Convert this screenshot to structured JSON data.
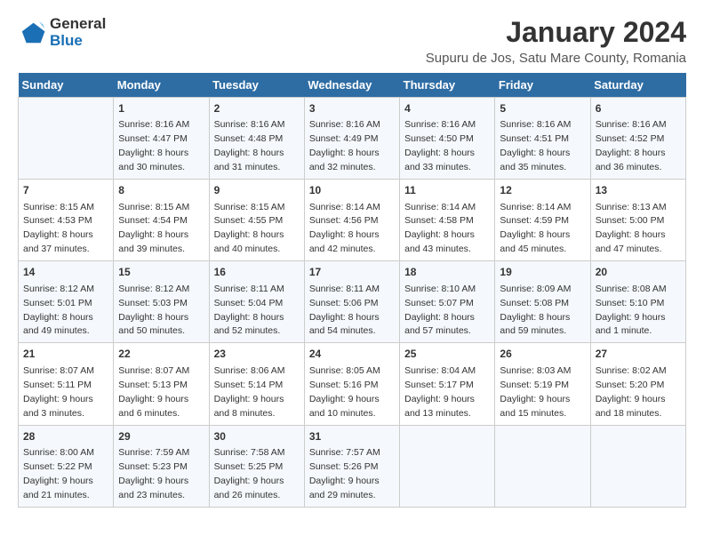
{
  "logo": {
    "line1": "General",
    "line2": "Blue"
  },
  "title": "January 2024",
  "subtitle": "Supuru de Jos, Satu Mare County, Romania",
  "weekdays": [
    "Sunday",
    "Monday",
    "Tuesday",
    "Wednesday",
    "Thursday",
    "Friday",
    "Saturday"
  ],
  "weeks": [
    [
      {
        "day": "",
        "sunrise": "",
        "sunset": "",
        "daylight": ""
      },
      {
        "day": "1",
        "sunrise": "Sunrise: 8:16 AM",
        "sunset": "Sunset: 4:47 PM",
        "daylight": "Daylight: 8 hours and 30 minutes."
      },
      {
        "day": "2",
        "sunrise": "Sunrise: 8:16 AM",
        "sunset": "Sunset: 4:48 PM",
        "daylight": "Daylight: 8 hours and 31 minutes."
      },
      {
        "day": "3",
        "sunrise": "Sunrise: 8:16 AM",
        "sunset": "Sunset: 4:49 PM",
        "daylight": "Daylight: 8 hours and 32 minutes."
      },
      {
        "day": "4",
        "sunrise": "Sunrise: 8:16 AM",
        "sunset": "Sunset: 4:50 PM",
        "daylight": "Daylight: 8 hours and 33 minutes."
      },
      {
        "day": "5",
        "sunrise": "Sunrise: 8:16 AM",
        "sunset": "Sunset: 4:51 PM",
        "daylight": "Daylight: 8 hours and 35 minutes."
      },
      {
        "day": "6",
        "sunrise": "Sunrise: 8:16 AM",
        "sunset": "Sunset: 4:52 PM",
        "daylight": "Daylight: 8 hours and 36 minutes."
      }
    ],
    [
      {
        "day": "7",
        "sunrise": "Sunrise: 8:15 AM",
        "sunset": "Sunset: 4:53 PM",
        "daylight": "Daylight: 8 hours and 37 minutes."
      },
      {
        "day": "8",
        "sunrise": "Sunrise: 8:15 AM",
        "sunset": "Sunset: 4:54 PM",
        "daylight": "Daylight: 8 hours and 39 minutes."
      },
      {
        "day": "9",
        "sunrise": "Sunrise: 8:15 AM",
        "sunset": "Sunset: 4:55 PM",
        "daylight": "Daylight: 8 hours and 40 minutes."
      },
      {
        "day": "10",
        "sunrise": "Sunrise: 8:14 AM",
        "sunset": "Sunset: 4:56 PM",
        "daylight": "Daylight: 8 hours and 42 minutes."
      },
      {
        "day": "11",
        "sunrise": "Sunrise: 8:14 AM",
        "sunset": "Sunset: 4:58 PM",
        "daylight": "Daylight: 8 hours and 43 minutes."
      },
      {
        "day": "12",
        "sunrise": "Sunrise: 8:14 AM",
        "sunset": "Sunset: 4:59 PM",
        "daylight": "Daylight: 8 hours and 45 minutes."
      },
      {
        "day": "13",
        "sunrise": "Sunrise: 8:13 AM",
        "sunset": "Sunset: 5:00 PM",
        "daylight": "Daylight: 8 hours and 47 minutes."
      }
    ],
    [
      {
        "day": "14",
        "sunrise": "Sunrise: 8:12 AM",
        "sunset": "Sunset: 5:01 PM",
        "daylight": "Daylight: 8 hours and 49 minutes."
      },
      {
        "day": "15",
        "sunrise": "Sunrise: 8:12 AM",
        "sunset": "Sunset: 5:03 PM",
        "daylight": "Daylight: 8 hours and 50 minutes."
      },
      {
        "day": "16",
        "sunrise": "Sunrise: 8:11 AM",
        "sunset": "Sunset: 5:04 PM",
        "daylight": "Daylight: 8 hours and 52 minutes."
      },
      {
        "day": "17",
        "sunrise": "Sunrise: 8:11 AM",
        "sunset": "Sunset: 5:06 PM",
        "daylight": "Daylight: 8 hours and 54 minutes."
      },
      {
        "day": "18",
        "sunrise": "Sunrise: 8:10 AM",
        "sunset": "Sunset: 5:07 PM",
        "daylight": "Daylight: 8 hours and 57 minutes."
      },
      {
        "day": "19",
        "sunrise": "Sunrise: 8:09 AM",
        "sunset": "Sunset: 5:08 PM",
        "daylight": "Daylight: 8 hours and 59 minutes."
      },
      {
        "day": "20",
        "sunrise": "Sunrise: 8:08 AM",
        "sunset": "Sunset: 5:10 PM",
        "daylight": "Daylight: 9 hours and 1 minute."
      }
    ],
    [
      {
        "day": "21",
        "sunrise": "Sunrise: 8:07 AM",
        "sunset": "Sunset: 5:11 PM",
        "daylight": "Daylight: 9 hours and 3 minutes."
      },
      {
        "day": "22",
        "sunrise": "Sunrise: 8:07 AM",
        "sunset": "Sunset: 5:13 PM",
        "daylight": "Daylight: 9 hours and 6 minutes."
      },
      {
        "day": "23",
        "sunrise": "Sunrise: 8:06 AM",
        "sunset": "Sunset: 5:14 PM",
        "daylight": "Daylight: 9 hours and 8 minutes."
      },
      {
        "day": "24",
        "sunrise": "Sunrise: 8:05 AM",
        "sunset": "Sunset: 5:16 PM",
        "daylight": "Daylight: 9 hours and 10 minutes."
      },
      {
        "day": "25",
        "sunrise": "Sunrise: 8:04 AM",
        "sunset": "Sunset: 5:17 PM",
        "daylight": "Daylight: 9 hours and 13 minutes."
      },
      {
        "day": "26",
        "sunrise": "Sunrise: 8:03 AM",
        "sunset": "Sunset: 5:19 PM",
        "daylight": "Daylight: 9 hours and 15 minutes."
      },
      {
        "day": "27",
        "sunrise": "Sunrise: 8:02 AM",
        "sunset": "Sunset: 5:20 PM",
        "daylight": "Daylight: 9 hours and 18 minutes."
      }
    ],
    [
      {
        "day": "28",
        "sunrise": "Sunrise: 8:00 AM",
        "sunset": "Sunset: 5:22 PM",
        "daylight": "Daylight: 9 hours and 21 minutes."
      },
      {
        "day": "29",
        "sunrise": "Sunrise: 7:59 AM",
        "sunset": "Sunset: 5:23 PM",
        "daylight": "Daylight: 9 hours and 23 minutes."
      },
      {
        "day": "30",
        "sunrise": "Sunrise: 7:58 AM",
        "sunset": "Sunset: 5:25 PM",
        "daylight": "Daylight: 9 hours and 26 minutes."
      },
      {
        "day": "31",
        "sunrise": "Sunrise: 7:57 AM",
        "sunset": "Sunset: 5:26 PM",
        "daylight": "Daylight: 9 hours and 29 minutes."
      },
      {
        "day": "",
        "sunrise": "",
        "sunset": "",
        "daylight": ""
      },
      {
        "day": "",
        "sunrise": "",
        "sunset": "",
        "daylight": ""
      },
      {
        "day": "",
        "sunrise": "",
        "sunset": "",
        "daylight": ""
      }
    ]
  ]
}
